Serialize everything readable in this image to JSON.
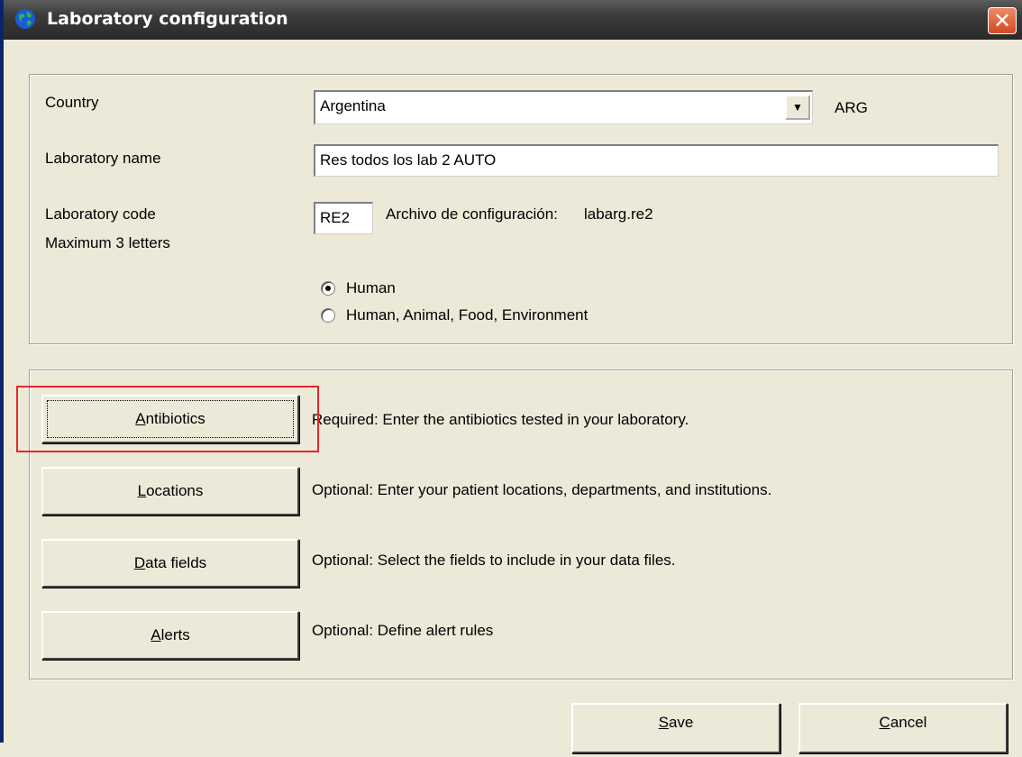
{
  "window": {
    "title": "Laboratory configuration",
    "close_glyph": "✕"
  },
  "form": {
    "country_label": "Country",
    "country_value": "Argentina",
    "country_code": "ARG",
    "lab_name_label": "Laboratory name",
    "lab_name_value": "Res todos los lab 2 AUTO",
    "lab_code_label": "Laboratory code",
    "lab_code_hint": "Maximum 3 letters",
    "lab_code_value": "RE2",
    "config_file_label": "Archivo de configuración:",
    "config_file_value": "labarg.re2",
    "radio_human": "Human",
    "radio_all": "Human, Animal, Food, Environment",
    "selected_radio": "Human"
  },
  "setup": {
    "antibiotics": {
      "label_first": "A",
      "label_rest": "ntibiotics",
      "desc": "Required:  Enter the antibiotics tested in your laboratory."
    },
    "locations": {
      "label_first": "L",
      "label_rest": "ocations",
      "desc": "Optional:  Enter your patient locations, departments, and institutions."
    },
    "data_fields": {
      "label_first": "D",
      "label_rest": "ata fields",
      "desc": "Optional:  Select the fields to include in your data files."
    },
    "alerts": {
      "label_first": "A",
      "label_rest": "lerts",
      "desc": "Optional:  Define alert rules"
    }
  },
  "footer": {
    "save_first": "S",
    "save_rest": "ave",
    "cancel_first": "C",
    "cancel_rest": "ancel"
  },
  "colors": {
    "highlight": "#e8262a",
    "face": "#ece9d8"
  }
}
